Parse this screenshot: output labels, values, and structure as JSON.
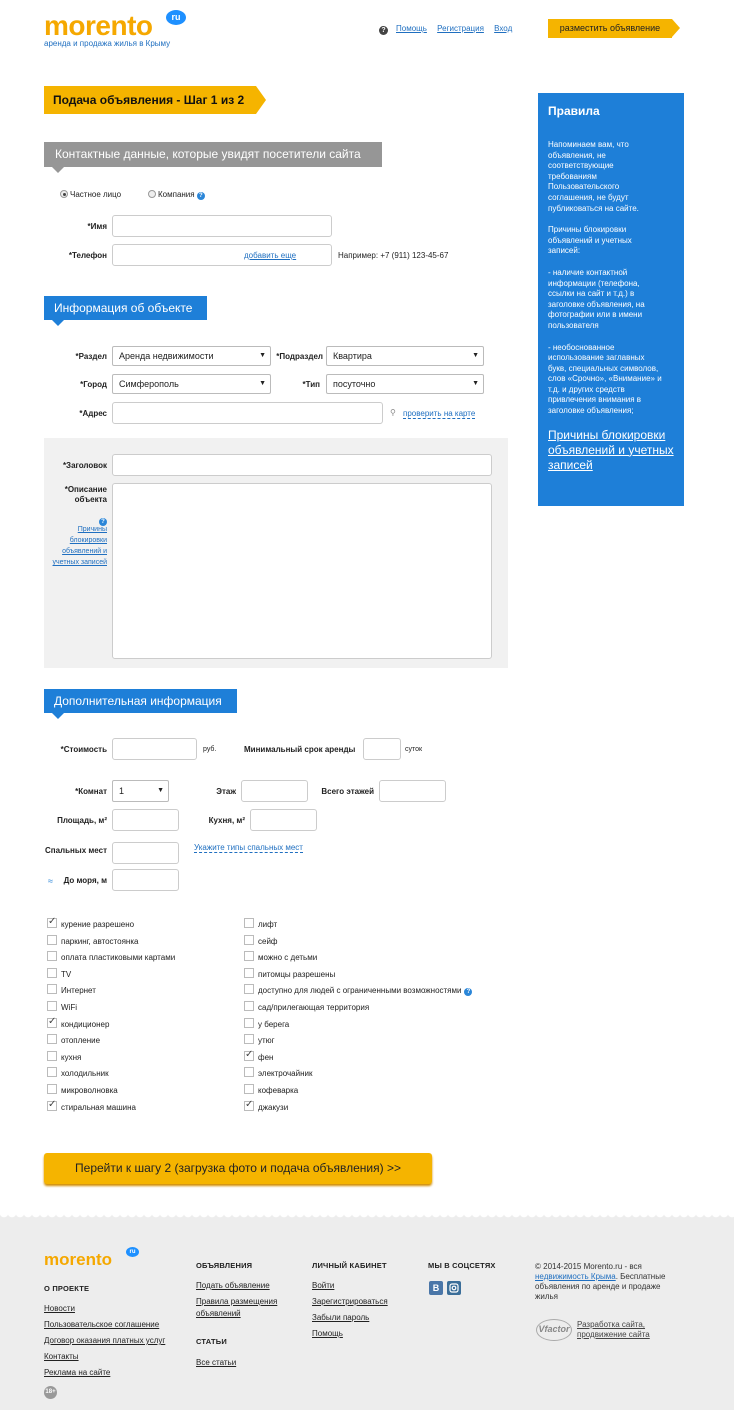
{
  "header": {
    "logo": "morento",
    "logo_badge": "ru",
    "tagline": "аренда и продажа жилья в Крыму",
    "help": "Помощь",
    "register": "Регистрация",
    "login": "Вход",
    "post_button": "разместить объявление"
  },
  "step_title": "Подача объявления - Шаг 1 из 2",
  "contacts": {
    "title": "Контактные данные, которые увидят посетители сайта",
    "radio_private": "Частное лицо",
    "radio_company": "Компания",
    "name_label": "*Имя",
    "phone_label": "*Телефон",
    "add_more": "добавить еще",
    "phone_example": "Например: +7 (911) 123-45-67"
  },
  "object": {
    "title": "Информация об объекте",
    "section_label": "*Раздел",
    "section_value": "Аренда недвижимости",
    "subsection_label": "*Подраздел",
    "subsection_value": "Квартира",
    "city_label": "*Город",
    "city_value": "Симферополь",
    "type_label": "*Тип",
    "type_value": "посуточно",
    "address_label": "*Адрес",
    "check_map": "проверить на карте",
    "heading_label": "*Заголовок",
    "description_label": "*Описание объекта",
    "block_reasons": "Причины блокировки объявлений и учетных записей"
  },
  "extra": {
    "title": "Дополнительная информация",
    "price_label": "*Стоимость",
    "price_unit": "руб.",
    "min_term_label": "Минимальный срок аренды",
    "min_term_unit": "суток",
    "rooms_label": "*Комнат",
    "rooms_value": "1",
    "floor_label": "Этаж",
    "total_floors_label": "Всего этажей",
    "area_label": "Площадь, м²",
    "kitchen_label": "Кухня, м²",
    "sleeping_label": "Спальных мест",
    "sleeping_types": "Укажите типы спальных мест",
    "sea_label": "До моря, м"
  },
  "amenities_left": [
    {
      "label": "курение разрешено",
      "checked": true
    },
    {
      "label": "паркинг, автостоянка",
      "checked": false
    },
    {
      "label": "оплата пластиковыми картами",
      "checked": false
    },
    {
      "label": "TV",
      "checked": false
    },
    {
      "label": "Интернет",
      "checked": false
    },
    {
      "label": "WiFi",
      "checked": false
    },
    {
      "label": "кондиционер",
      "checked": true
    },
    {
      "label": "отопление",
      "checked": false
    },
    {
      "label": "кухня",
      "checked": false
    },
    {
      "label": "холодильник",
      "checked": false
    },
    {
      "label": "микроволновка",
      "checked": false
    },
    {
      "label": "стиральная машина",
      "checked": true
    }
  ],
  "amenities_right": [
    {
      "label": "лифт",
      "checked": false
    },
    {
      "label": "сейф",
      "checked": false
    },
    {
      "label": "можно с детьми",
      "checked": false
    },
    {
      "label": "питомцы разрешены",
      "checked": false
    },
    {
      "label": "доступно для людей с ограниченными возможностями",
      "checked": false
    },
    {
      "label": "сад/прилегающая территория",
      "checked": false
    },
    {
      "label": "у берега",
      "checked": false
    },
    {
      "label": "утюг",
      "checked": false
    },
    {
      "label": "фен",
      "checked": true
    },
    {
      "label": "электрочайник",
      "checked": false
    },
    {
      "label": "кофеварка",
      "checked": false
    },
    {
      "label": "джакузи",
      "checked": true
    }
  ],
  "next_button": "Перейти к шагу 2 (загрузка фото и подача объявления) >>",
  "rules": {
    "title": "Правила",
    "p1": "Напоминаем вам, что\nобъявления, не\nсоответствующие\nтребованиям\nПользовательского\nсоглашения, не будут\nпубликоваться на сайте.",
    "p2": "Причины блокировки\nобъявлений и учетных\nзаписей:",
    "p3": "- наличие контактной\nинформации (телефона,\nссылки на сайт и т.д.) в\nзаголовке объявления, на\nфотографии или в имени\nпользователя",
    "p4": "- необоснованное\nиспользование заглавных\nбукв, специальных символов,\nслов «Срочно», «Внимание» и\nт.д. и других средств\nпривлечения внимания в\nзаголовке объявления;",
    "link": "Причины блокировки объявлений и учетных записей"
  },
  "footer": {
    "logo": "morento",
    "logo_badge": "ru",
    "about_title": "О ПРОЕКТЕ",
    "about_links": [
      "Новости",
      "Пользовательское соглашение",
      "Договор оказания платных услуг",
      "Контакты",
      "Реклама на сайте"
    ],
    "age": "18+",
    "ads_title": "ОБЪЯВЛЕНИЯ",
    "ads_links": [
      "Подать объявление",
      "Правила размещения",
      "объявлений"
    ],
    "articles_title": "СТАТЬИ",
    "articles_link": "Все статьи",
    "cabinet_title": "ЛИЧНЫЙ КАБИНЕТ",
    "cabinet_links": [
      "Войти",
      "Зарегистрироваться",
      "Забыли пароль",
      "Помощь"
    ],
    "social_title": "МЫ В СОЦСЕТЯХ",
    "vk": "В",
    "copyright_pre": "© 2014-2015 Morento.ru - вся",
    "copyright_link": "недвижимость Крыма",
    "copyright_post": ". Бесплатные объявления по аренде и продаже жилья",
    "dev_logo": "Vfactor",
    "dev_link1": "Разработка сайта,",
    "dev_link2": "продвижение сайта"
  }
}
